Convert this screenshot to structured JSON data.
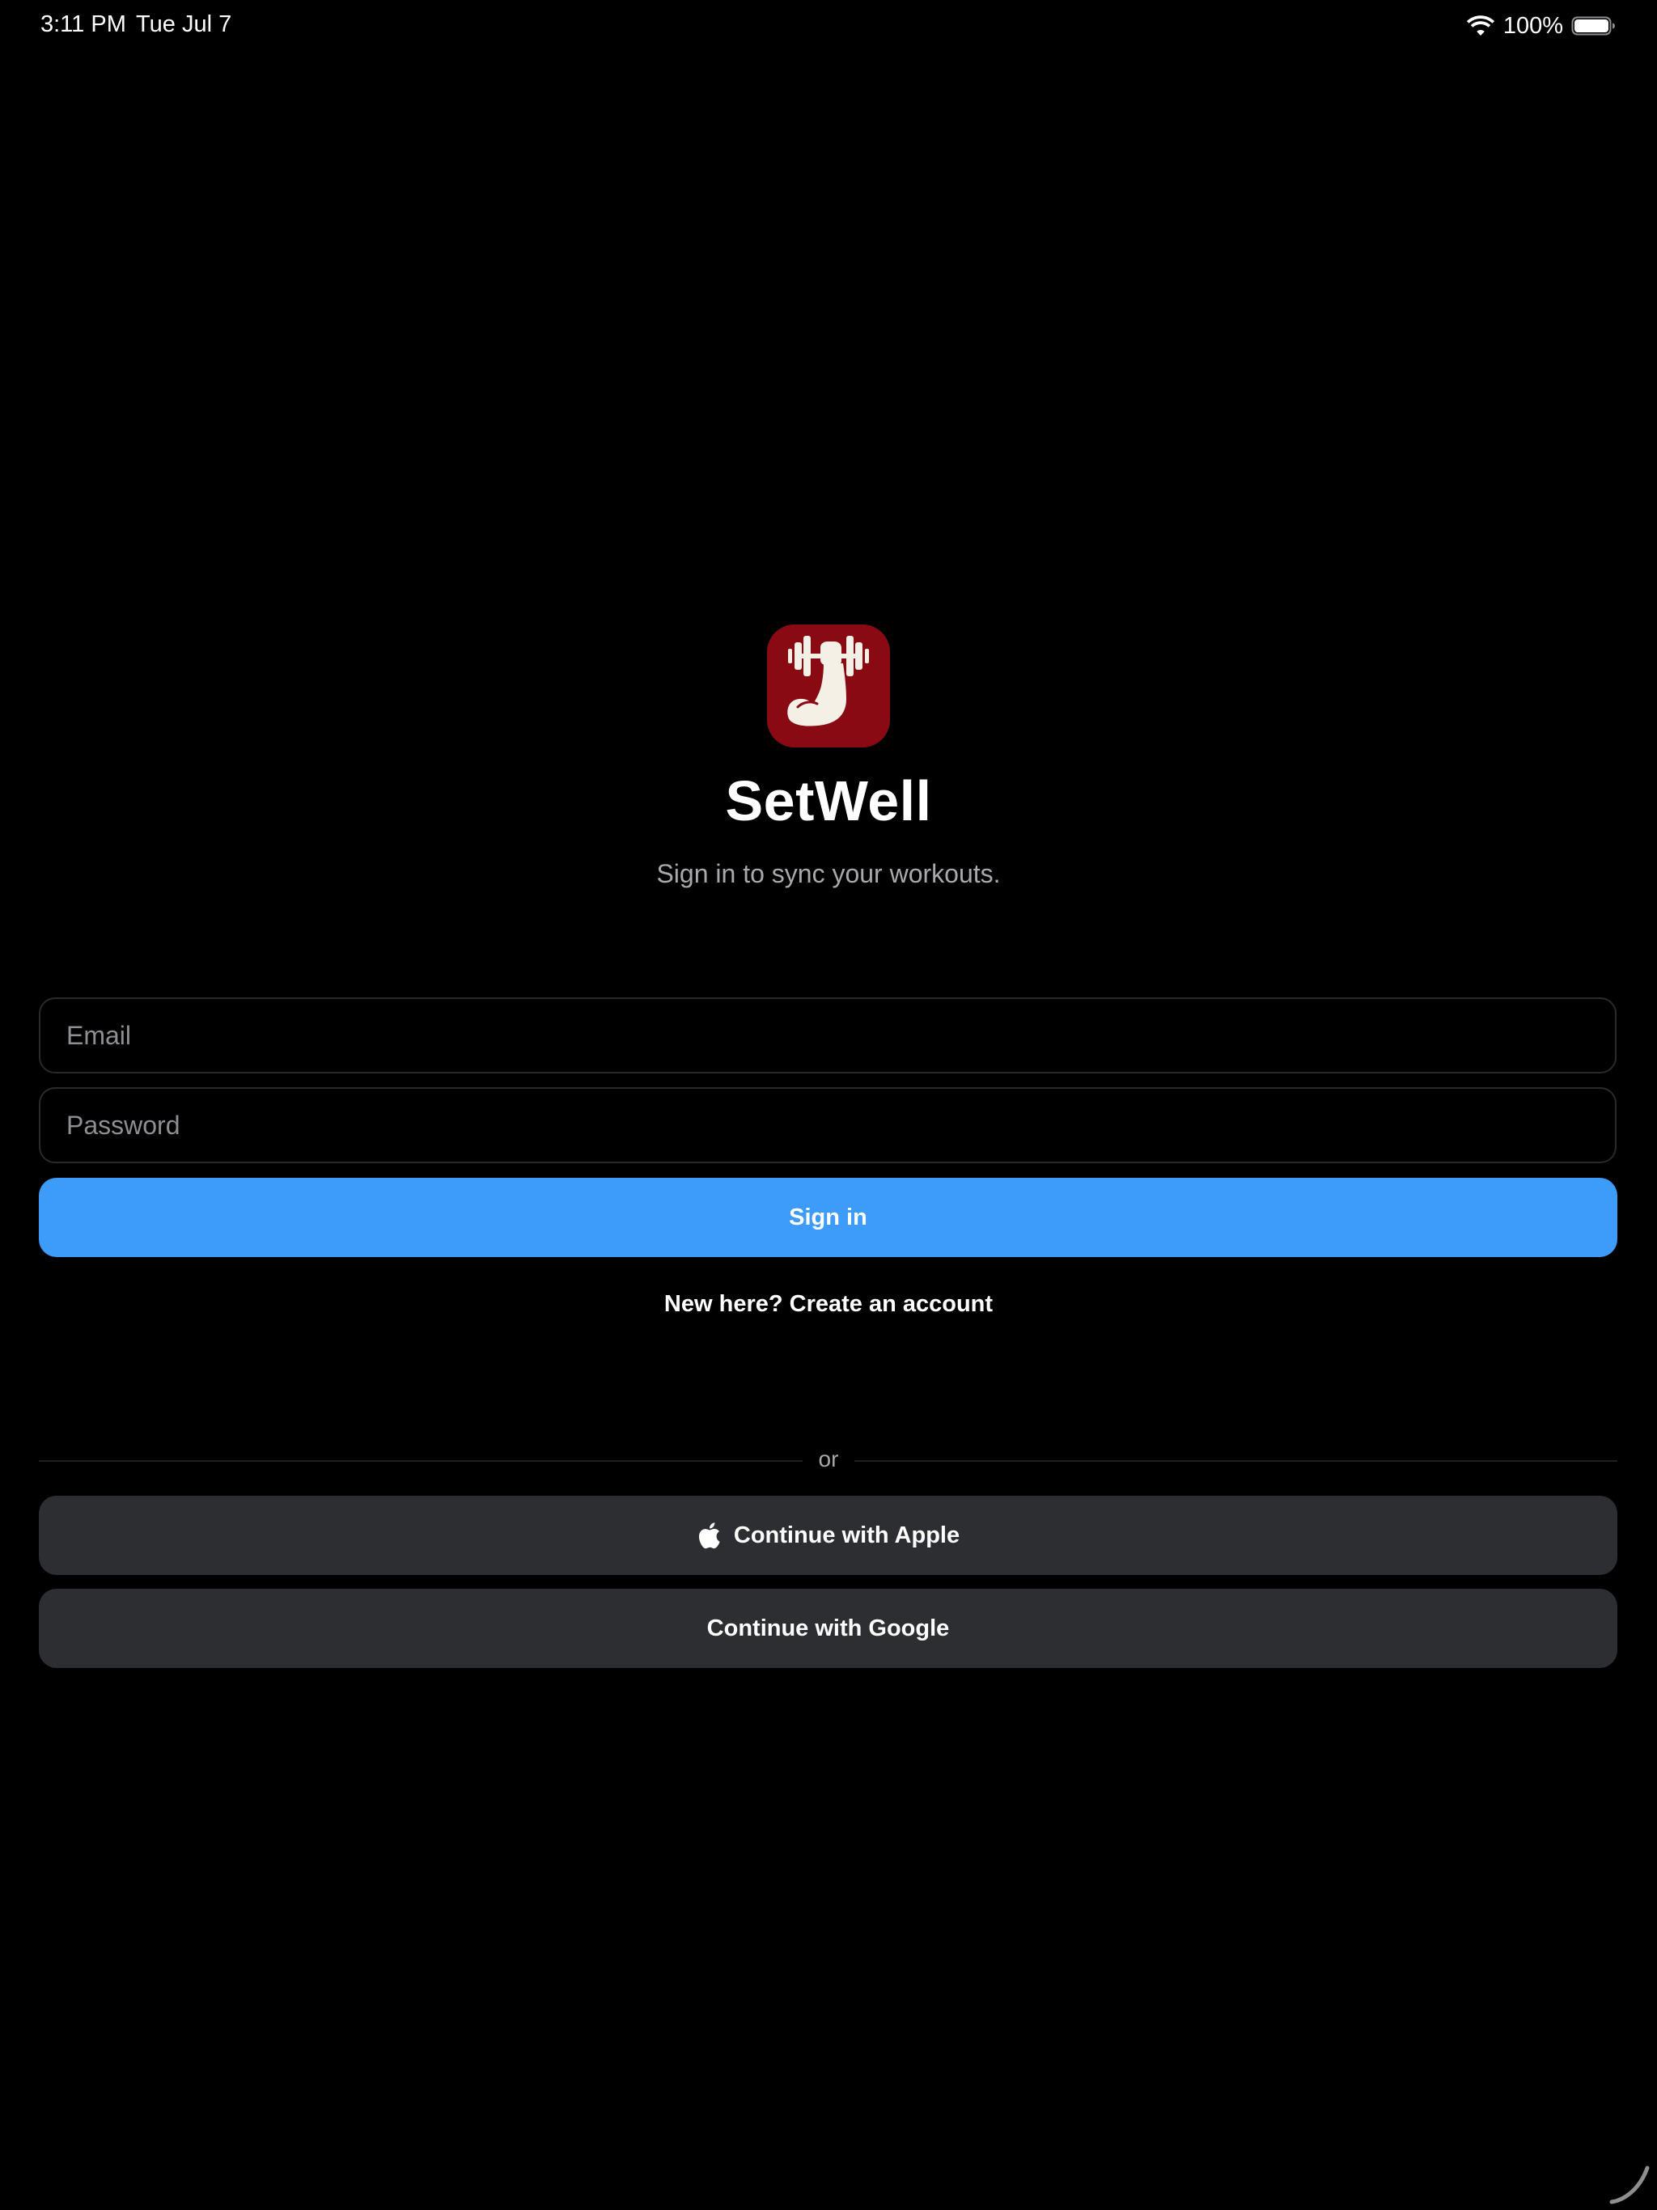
{
  "status_bar": {
    "time": "3:11 PM",
    "date": "Tue Jul 7",
    "battery_percent": "100%"
  },
  "header": {
    "app_name": "SetWell",
    "subtitle": "Sign in to sync your workouts.",
    "logo_icon": "dumbbell-arm-icon"
  },
  "form": {
    "email_placeholder": "Email",
    "password_placeholder": "Password",
    "signin_label": "Sign in",
    "create_account_label": "New here? Create an account"
  },
  "divider": {
    "label": "or"
  },
  "social": {
    "apple_label": "Continue with Apple",
    "google_label": "Continue with Google"
  },
  "colors": {
    "background": "#000000",
    "accent": "#3d9cfa",
    "logo_background": "#8a0a14",
    "social_button": "#2c2e32"
  }
}
